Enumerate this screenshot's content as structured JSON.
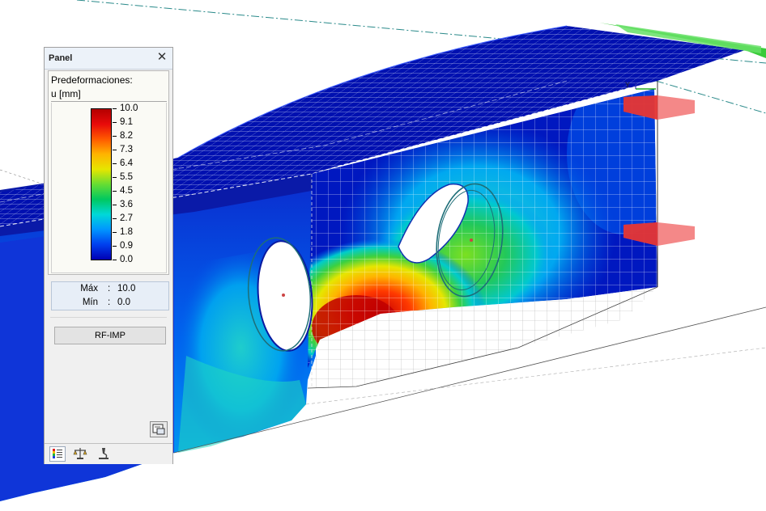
{
  "viewport": {
    "description_icon": "3d-model-view"
  },
  "panel": {
    "title": "Panel",
    "close_icon": "close-icon",
    "quantity_label": "Predeformaciones:",
    "unit_label": "u [mm]",
    "legend": {
      "values": [
        "10.0",
        "9.1",
        "8.2",
        "7.3",
        "6.4",
        "5.5",
        "4.5",
        "3.6",
        "2.7",
        "1.8",
        "0.9",
        "0.0"
      ],
      "colors": [
        "#b40000",
        "#e80a0a",
        "#ff5a00",
        "#ffb400",
        "#e6e600",
        "#66dd33",
        "#00c860",
        "#00d8d8",
        "#0096ff",
        "#0040ee",
        "#0000b4"
      ]
    },
    "stats": {
      "max_label": "Máx",
      "max_value": "10.0",
      "min_label": "Mín",
      "min_value": "0.0"
    },
    "button_label": "RF-IMP",
    "print_icon": "print-icon",
    "tabs": [
      {
        "icon": "color-scale-icon",
        "active": true
      },
      {
        "icon": "balance-scale-icon",
        "active": false
      },
      {
        "icon": "microscope-icon",
        "active": false
      }
    ]
  }
}
